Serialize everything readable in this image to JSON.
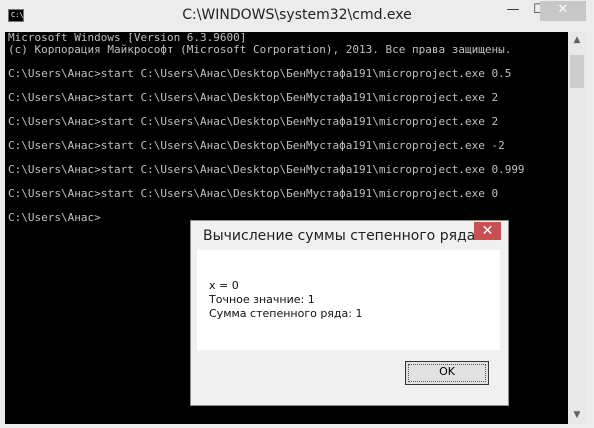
{
  "window": {
    "title": "C:\\WINDOWS\\system32\\cmd.exe",
    "icon_label": "C:\\",
    "minimize_glyph": "—",
    "maximize_glyph": "☐",
    "close_glyph": "✕"
  },
  "console": {
    "header": [
      "Microsoft Windows [Version 6.3.9600]",
      "(c) Корпорация Майкрософт (Microsoft Corporation), 2013. Все права защищены."
    ],
    "commands": [
      "C:\\Users\\Анас>start C:\\Users\\Анас\\Desktop\\БенМустафа191\\microproject.exe 0.5",
      "C:\\Users\\Анас>start C:\\Users\\Анас\\Desktop\\БенМустафа191\\microproject.exe 2",
      "C:\\Users\\Анас>start C:\\Users\\Анас\\Desktop\\БенМустафа191\\microproject.exe 2",
      "C:\\Users\\Анас>start C:\\Users\\Анас\\Desktop\\БенМустафа191\\microproject.exe -2",
      "C:\\Users\\Анас>start C:\\Users\\Анас\\Desktop\\БенМустафа191\\microproject.exe 0.999",
      "C:\\Users\\Анас>start C:\\Users\\Анас\\Desktop\\БенМустафа191\\microproject.exe 0"
    ],
    "prompt": "C:\\Users\\Анас>",
    "text_color": "#c0c0c0",
    "background": "#000000"
  },
  "dialog": {
    "title": "Вычисление суммы степенного ряда",
    "close_glyph": "✕",
    "lines": [
      "x = 0",
      "Точное значние: 1",
      "Сумма степенного ряда: 1"
    ],
    "ok_label": "OK",
    "close_color": "#c75050"
  },
  "scrollbar": {
    "up_glyph": "▲",
    "down_glyph": "▼"
  }
}
